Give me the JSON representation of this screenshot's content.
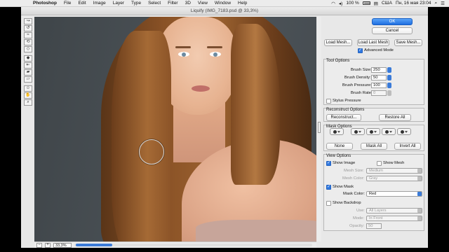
{
  "menubar": {
    "app": "Photoshop",
    "items": [
      "File",
      "Edit",
      "Image",
      "Layer",
      "Type",
      "Select",
      "Filter",
      "3D",
      "View",
      "Window",
      "Help"
    ],
    "battery": "100 %",
    "locale": "США",
    "datetime": "Пн, 16 мая  23:04"
  },
  "window": {
    "title": "Liquify (IMG_7183.psd @ 33,3%)"
  },
  "toolstrip": {
    "icons": [
      "forward-warp-tool-icon",
      "reconstruct-tool-icon",
      "smooth-tool-icon",
      "twirl-tool-icon",
      "pucker-tool-icon",
      "bloat-tool-icon",
      "push-left-tool-icon",
      "freeze-mask-tool-icon",
      "thaw-mask-tool-icon",
      "face-tool-icon",
      "hand-tool-icon",
      "zoom-tool-icon"
    ]
  },
  "canvas": {
    "zoom_value": "33,3%",
    "zoom_minus": "−",
    "zoom_plus": "+"
  },
  "panel": {
    "ok": "OK",
    "cancel": "Cancel",
    "load_mesh": "Load Mesh...",
    "load_last_mesh": "Load Last Mesh",
    "save_mesh": "Save Mesh...",
    "advanced_mode": "Advanced Mode",
    "tool_options": {
      "title": "Tool Options",
      "brush_size_label": "Brush Size:",
      "brush_size": "250",
      "brush_density_label": "Brush Density:",
      "brush_density": "50",
      "brush_pressure_label": "Brush Pressure:",
      "brush_pressure": "100",
      "brush_rate_label": "Brush Rate:",
      "brush_rate": "0",
      "stylus_pressure": "Stylus Pressure"
    },
    "reconstruct_options": {
      "title": "Reconstruct Options",
      "reconstruct": "Reconstruct...",
      "restore_all": "Restore All"
    },
    "mask_options": {
      "title": "Mask Options",
      "none": "None",
      "mask_all": "Mask All",
      "invert_all": "Invert All"
    },
    "view_options": {
      "title": "View Options",
      "show_image": "Show Image",
      "show_mesh": "Show Mesh",
      "mesh_size_label": "Mesh Size:",
      "mesh_size": "Medium",
      "mesh_color_label": "Mesh Color:",
      "mesh_color": "Gray",
      "show_mask": "Show Mask",
      "mask_color_label": "Mask Color:",
      "mask_color": "Red",
      "show_backdrop": "Show Backdrop",
      "use_label": "Use:",
      "use": "All Layers",
      "mode_label": "Mode:",
      "mode": "In Front",
      "opacity_label": "Opacity:",
      "opacity": "50"
    }
  },
  "colors": {
    "accent": "#2f78e0",
    "canvas_bg": "#4a5055"
  }
}
